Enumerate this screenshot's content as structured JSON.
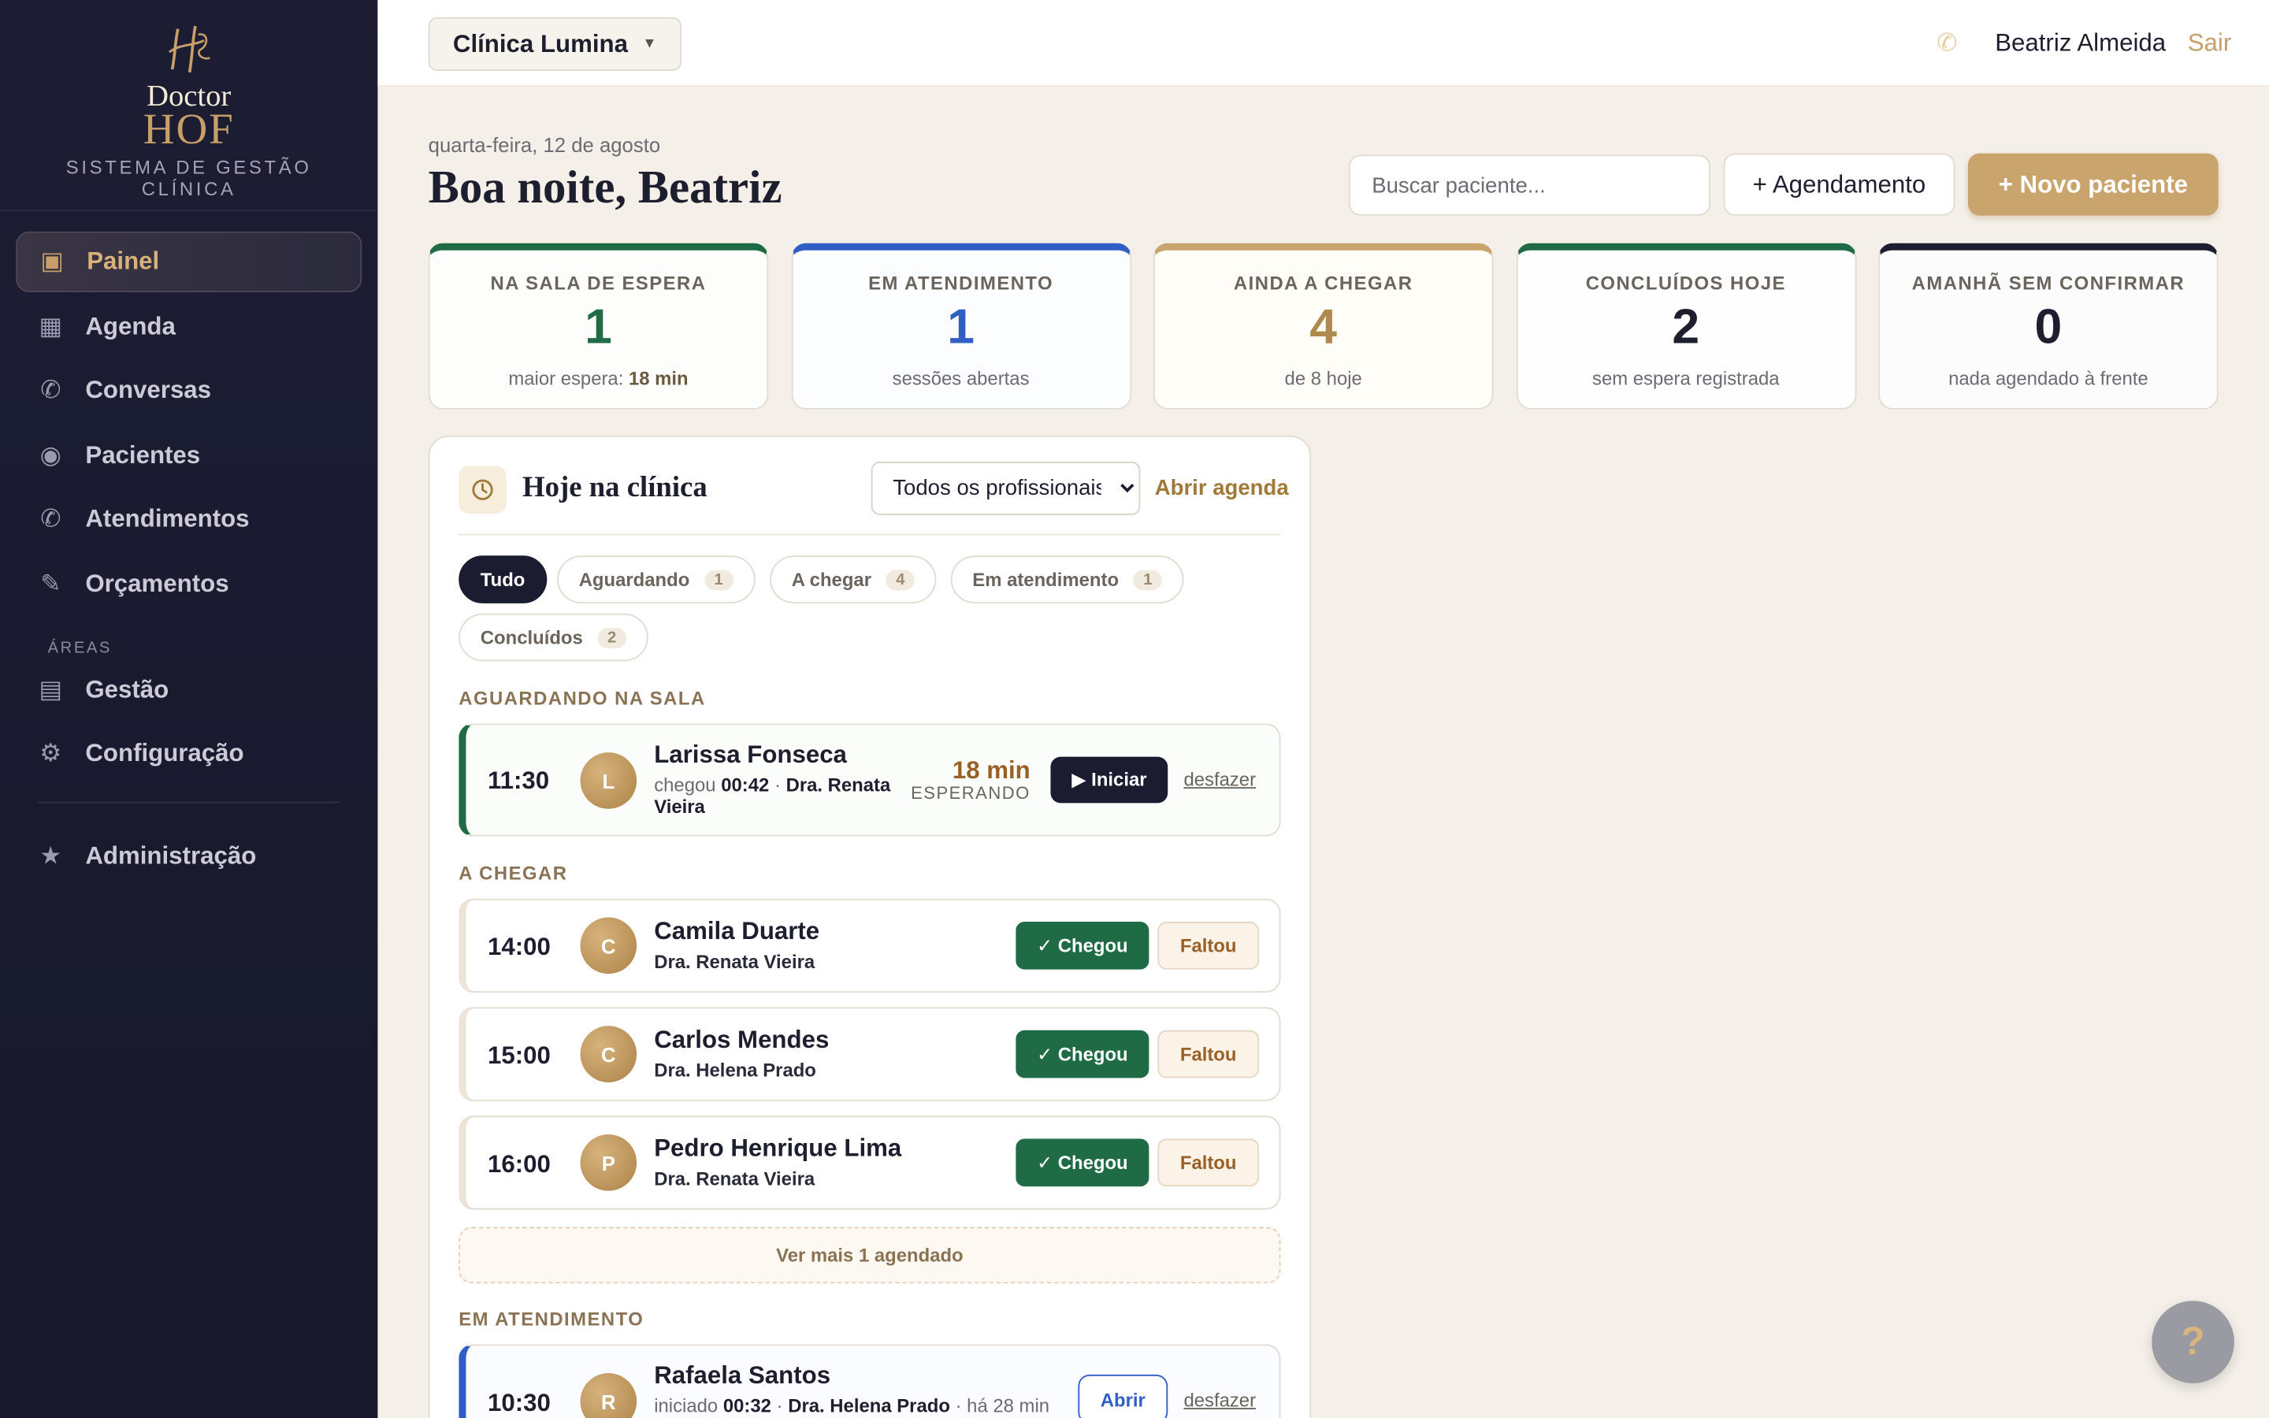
{
  "brand": {
    "name_top": "Doctor",
    "name_bottom": "HOF",
    "tagline": "SISTEMA DE GESTÃO CLÍNICA",
    "accent": "#c7a069",
    "sidebar_bg": "#1c1d33"
  },
  "sidebar": {
    "items": [
      {
        "label": "Painel",
        "icon": "dashboard-icon",
        "active": true
      },
      {
        "label": "Agenda",
        "icon": "calendar-icon"
      },
      {
        "label": "Conversas",
        "icon": "chat-icon"
      },
      {
        "label": "Pacientes",
        "icon": "patients-icon"
      },
      {
        "label": "Atendimentos",
        "icon": "appointments-icon"
      },
      {
        "label": "Orçamentos",
        "icon": "quote-icon"
      }
    ],
    "section_label": "ÁREAS",
    "area_items": [
      {
        "label": "Gestão",
        "icon": "management-icon"
      },
      {
        "label": "Configuração",
        "icon": "gear-icon"
      }
    ],
    "admin_item": {
      "label": "Administração",
      "icon": "star-icon"
    }
  },
  "topbar": {
    "clinic": "Clínica Lumina",
    "user_name": "Beatriz Almeida",
    "logout": "Sair"
  },
  "header": {
    "date": "quarta-feira, 12 de agosto",
    "greeting": "Boa noite, Beatriz",
    "search_placeholder": "Buscar paciente...",
    "add_appointment": "+ Agendamento",
    "new_patient": "+ Novo paciente"
  },
  "kpis": [
    {
      "label": "NA SALA DE ESPERA",
      "value": "1",
      "sub_prefix": "maior espera: ",
      "sub_strong": "18 min",
      "color": "#1f6b45"
    },
    {
      "label": "EM ATENDIMENTO",
      "value": "1",
      "sub": "sessões abertas",
      "color": "#2f5fc4"
    },
    {
      "label": "AINDA A CHEGAR",
      "value": "4",
      "sub": "de 8 hoje",
      "color": "#b08a4d"
    },
    {
      "label": "CONCLUÍDOS HOJE",
      "value": "2",
      "sub": "sem espera registrada",
      "color": "#1e1f2e"
    },
    {
      "label": "AMANHÃ SEM CONFIRMAR",
      "value": "0",
      "sub": "nada agendado à frente",
      "color": "#1e1f2e"
    }
  ],
  "panel": {
    "title": "Hoje na clínica",
    "filter_selected": "Todos os profissionais",
    "open_agenda": "Abrir agenda",
    "chips": [
      {
        "label": "Tudo",
        "active": true
      },
      {
        "label": "Aguardando",
        "count": "1"
      },
      {
        "label": "A chegar",
        "count": "4"
      },
      {
        "label": "Em atendimento",
        "count": "1"
      },
      {
        "label": "Concluídos",
        "count": "2"
      }
    ],
    "waiting": {
      "label": "AGUARDANDO NA SALA",
      "row": {
        "time": "11:30",
        "initial": "L",
        "name": "Larissa Fonseca",
        "arrived_prefix": "chegou",
        "arrived_time": "00:42",
        "sep": "·",
        "doctor": "Dra. Renata Vieira",
        "wait_min": "18 min",
        "wait_label": "ESPERANDO",
        "start": "▶ Iniciar",
        "undo": "desfazer"
      }
    },
    "arriving": {
      "label": "A CHEGAR",
      "arrived_btn": "✓ Chegou",
      "missed_btn": "Faltou",
      "rows": [
        {
          "time": "14:00",
          "initial": "C",
          "name": "Camila Duarte",
          "doctor": "Dra. Renata Vieira"
        },
        {
          "time": "15:00",
          "initial": "C",
          "name": "Carlos Mendes",
          "doctor": "Dra. Helena Prado"
        },
        {
          "time": "16:00",
          "initial": "P",
          "name": "Pedro Henrique Lima",
          "doctor": "Dra. Renata Vieira"
        }
      ],
      "see_more": "Ver mais 1 agendado"
    },
    "in_service": {
      "label": "EM ATENDIMENTO",
      "row": {
        "time": "10:30",
        "initial": "R",
        "name": "Rafaela Santos",
        "started_prefix": "iniciado",
        "started_time": "00:32",
        "sep": "·",
        "doctor": "Dra. Helena Prado",
        "elapsed": "· há 28 min",
        "open": "Abrir",
        "undo": "desfazer"
      }
    }
  },
  "help": "?"
}
